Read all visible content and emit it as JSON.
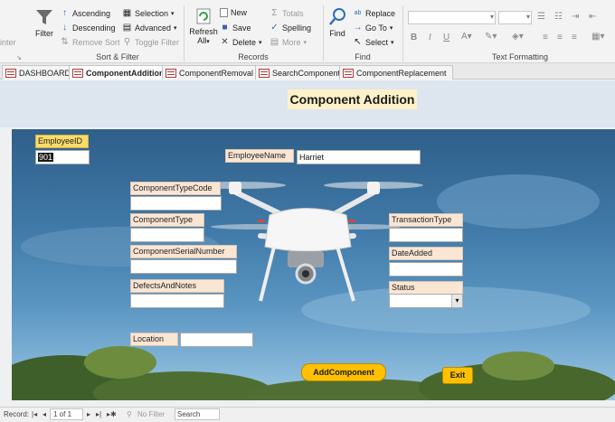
{
  "ribbon": {
    "printer_partial": "inter",
    "filter_label": "Filter",
    "ascending": "Ascending",
    "descending": "Descending",
    "remove_sort": "Remove Sort",
    "selection": "Selection",
    "advanced": "Advanced",
    "toggle_filter": "Toggle Filter",
    "sort_filter_group": "Sort & Filter",
    "refresh_line1": "Refresh",
    "refresh_line2": "All",
    "new": "New",
    "save": "Save",
    "delete": "Delete",
    "totals": "Totals",
    "spelling": "Spelling",
    "more": "More",
    "records_group": "Records",
    "find_label": "Find",
    "replace": "Replace",
    "go_to": "Go To",
    "select": "Select",
    "find_group": "Find",
    "bold": "B",
    "italic": "I",
    "underline": "U",
    "text_formatting_group": "Text Formatting"
  },
  "tabs": [
    {
      "label": "DASHBOARD",
      "active": false
    },
    {
      "label": "ComponentAddition",
      "active": true
    },
    {
      "label": "ComponentRemoval",
      "active": false
    },
    {
      "label": "SearchComponent",
      "active": false
    },
    {
      "label": "ComponentReplacement",
      "active": false
    }
  ],
  "form": {
    "title": "Component Addition",
    "fields": {
      "employee_id_label": "EmployeeID",
      "employee_id_value": "901",
      "employee_name_label": "EmployeeName",
      "employee_name_value": "Harriet",
      "component_type_code_label": "ComponentTypeCode",
      "component_type_label": "ComponentType",
      "component_serial_label": "ComponentSerialNumber",
      "defects_label": "DefectsAndNotes",
      "location_label": "Location",
      "transaction_type_label": "TransactionType",
      "date_added_label": "DateAdded",
      "status_label": "Status"
    },
    "add_button": "AddComponent",
    "exit_button": "Exit"
  },
  "status_bar": {
    "record_label": "Record:",
    "record_position": "1 of 1",
    "no_filter": "No Filter",
    "search_placeholder": "Search"
  },
  "colors": {
    "label_fill": "#fbe5d3",
    "id_label_fill": "#fbdb6a",
    "button_fill": "#ffc000",
    "title_fill": "#fdf1c9"
  }
}
